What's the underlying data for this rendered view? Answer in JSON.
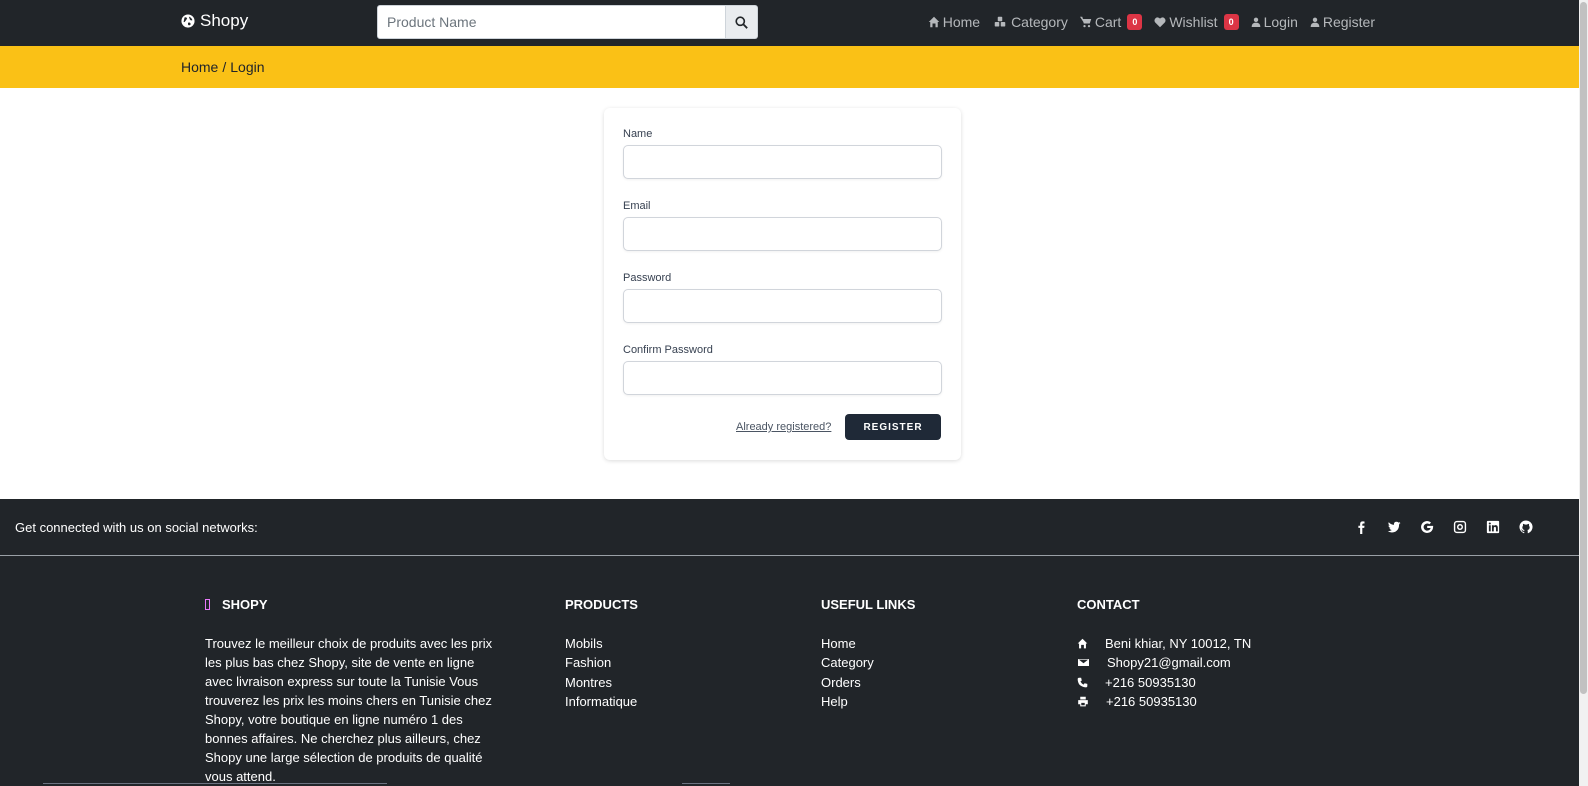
{
  "navbar": {
    "brand": "Shopy",
    "search_placeholder": "Product Name",
    "links": [
      {
        "label": "Home",
        "icon": "home-icon"
      },
      {
        "label": "Category",
        "icon": "cubes-icon"
      },
      {
        "label": "Cart",
        "icon": "cart-icon",
        "badge": "0"
      },
      {
        "label": "Wishlist",
        "icon": "heart-icon",
        "badge": "0"
      },
      {
        "label": "Login",
        "icon": "user-icon"
      },
      {
        "label": "Register",
        "icon": "user-icon"
      }
    ]
  },
  "breadcrumb": {
    "home": "Home",
    "separator": "/",
    "current": "Login"
  },
  "form": {
    "name_label": "Name",
    "email_label": "Email",
    "password_label": "Password",
    "confirm_label": "Confirm Password",
    "already_link": "Already registered?",
    "register_button": "Register"
  },
  "footer": {
    "social_text": "Get connected with us on social networks:",
    "social_icons": [
      "facebook-icon",
      "twitter-icon",
      "google-icon",
      "instagram-icon",
      "linkedin-icon",
      "github-icon"
    ],
    "about": {
      "title": "SHOPY",
      "text": "Trouvez le meilleur choix de produits avec les prix les plus bas chez Shopy, site de vente en ligne avec livraison express sur toute la Tunisie Vous trouverez les prix les moins chers en Tunisie chez Shopy, votre boutique en ligne numéro 1 des bonnes affaires. Ne cherchez plus ailleurs, chez Shopy une large sélection de produits de qualité vous attend."
    },
    "products": {
      "title": "PRODUCTS",
      "items": [
        "Mobils",
        "Fashion",
        "Montres",
        "Informatique"
      ]
    },
    "useful": {
      "title": "USEFUL LINKS",
      "items": [
        "Home",
        "Category",
        "Orders",
        "Help"
      ]
    },
    "contact": {
      "title": "CONTACT",
      "address": "Beni khiar, NY 10012, TN",
      "email": "Shopy21@gmail.com",
      "phone": "+216 50935130",
      "fax": "+216 50935130"
    }
  },
  "colors": {
    "navbar": "#212529",
    "accent": "#fac116",
    "badge": "#dc3545",
    "button": "#1f2937"
  }
}
